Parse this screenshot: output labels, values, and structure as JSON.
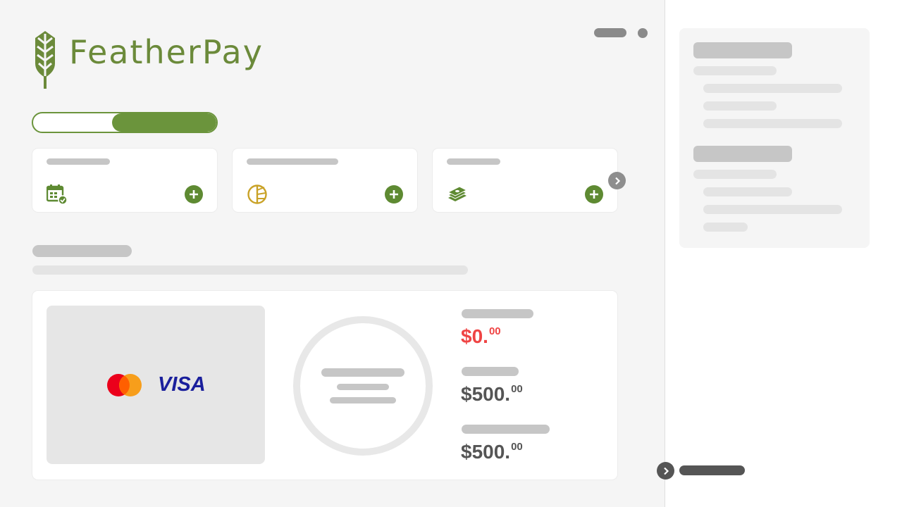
{
  "brand": {
    "name": "FeatherPay",
    "color": "#6b8a3a"
  },
  "theme": {
    "accent": "#5e8a32",
    "negative": "#ef4444"
  },
  "cards": [
    {
      "icon": "calendar-check-icon",
      "icon_color": "#5e8a32"
    },
    {
      "icon": "pie-chart-icon",
      "icon_color": "#c9a227"
    },
    {
      "icon": "money-stack-icon",
      "icon_color": "#5e8a32"
    }
  ],
  "payment_methods": [
    "mastercard-logo",
    "visa-logo"
  ],
  "visa_label": "VISA",
  "balances": [
    {
      "main": "$0.",
      "cents": "00"
    },
    {
      "main": "$500.",
      "cents": "00"
    },
    {
      "main": "$500.",
      "cents": "00"
    }
  ]
}
